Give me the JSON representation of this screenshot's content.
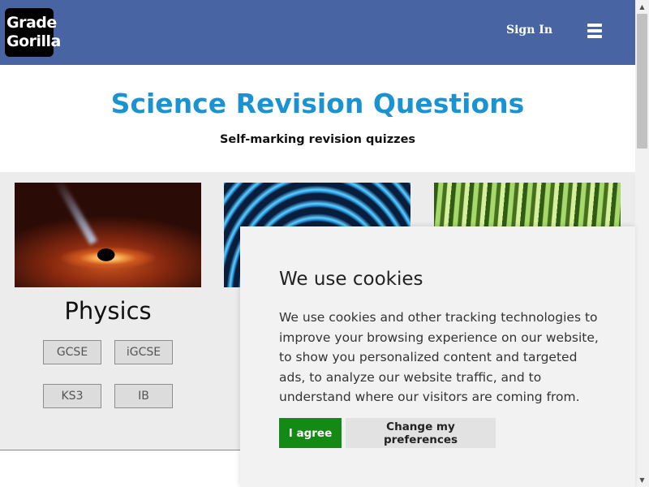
{
  "header": {
    "logo_line1": "Grade",
    "logo_line2": "Gorilla",
    "signin_label": "Sign In",
    "menu_icon": "hamburger-menu-icon",
    "background_color": "#4864a2"
  },
  "hero": {
    "title": "Science Revision Questions",
    "subtitle": "Self-marking revision quizzes",
    "title_color": "#1b93d1"
  },
  "subjects": [
    {
      "name": "Physics",
      "image": "black-hole-image",
      "levels": [
        "GCSE",
        "iGCSE",
        "KS3",
        "IB"
      ]
    },
    {
      "name": "",
      "image": "blue-waves-image",
      "levels": []
    },
    {
      "name": "",
      "image": "bamboo-forest-image",
      "levels": []
    }
  ],
  "cookie_banner": {
    "title": "We use cookies",
    "text": "We use cookies and other tracking technologies to improve your browsing experience on our website, to show you personalized content and targeted ads, to analyze our website traffic, and to understand where our visitors are coming from.",
    "agree_label": "I agree",
    "preferences_label": "Change my preferences",
    "agree_color": "#138a14"
  },
  "scrollbar": {
    "up_icon": "scroll-up-arrow-icon",
    "down_icon": "scroll-down-arrow-icon"
  }
}
